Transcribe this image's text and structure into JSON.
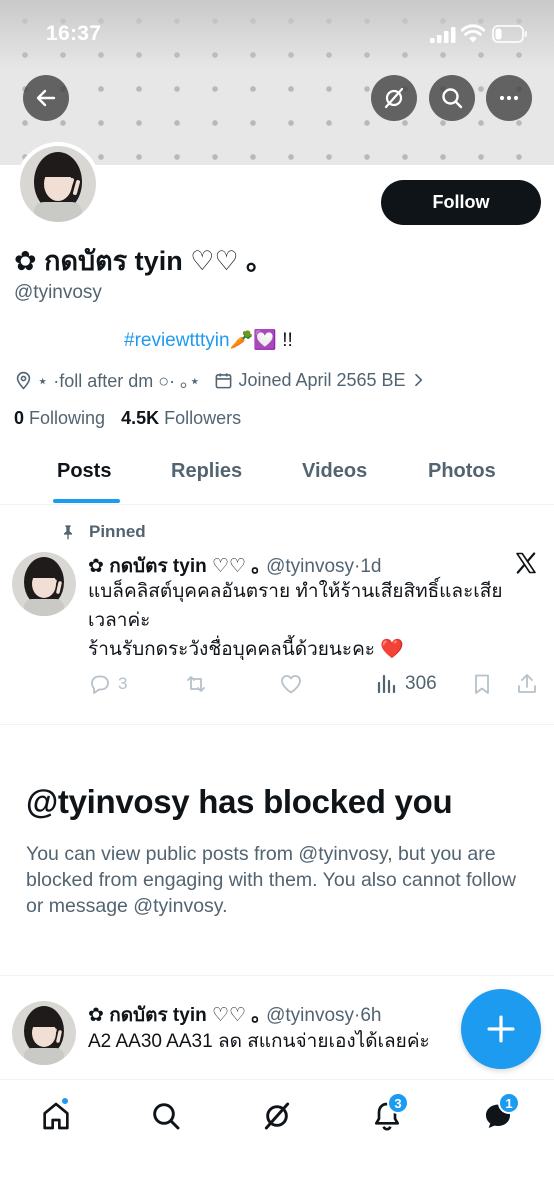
{
  "status_bar": {
    "time": "16:37"
  },
  "profile": {
    "display_name": "✿ กดบัตร tyin ♡♡ ｡",
    "handle": "@tyinvosy",
    "follow_label": "Follow",
    "bio_hashtag": "#reviewtttyin",
    "bio_suffix": "🥕💟 !!",
    "location": "⋆ ·foll after dm ○· ｡⋆",
    "joined": "Joined April 2565 BE",
    "following_count": "0",
    "following_label": "Following",
    "followers_count": "4.5K",
    "followers_label": "Followers"
  },
  "tabs": [
    {
      "label": "Posts",
      "active": true
    },
    {
      "label": "Replies",
      "active": false
    },
    {
      "label": "Videos",
      "active": false
    },
    {
      "label": "Photos",
      "active": false
    }
  ],
  "pinned_tweet": {
    "pinned_label": "Pinned",
    "author_name": "✿ กดบัตร tyin ♡♡ ｡",
    "author_handle": "@tyinvosy",
    "time": "1d",
    "text_line1": "แบล็คลิสต์บุคคลอันตราย ทำให้ร้านเสียสิทธิ์และเสีย",
    "text_line2": "เวลาค่ะ",
    "text_line3": "ร้านรับกดระวังชื่อบุคคลนี้ด้วยนะคะ ❤️",
    "replies": "3",
    "views": "306"
  },
  "blocked": {
    "title": "@tyinvosy has blocked you",
    "description": "You can view public posts from @tyinvosy, but you are blocked from engaging with them. You also cannot follow or message @tyinvosy."
  },
  "second_tweet": {
    "author_name": "✿ กดบัตร tyin ♡♡ ｡",
    "author_handle": "@tyinvosy",
    "time": "6h",
    "text": "A2 AA30 AA31 ลด สแกนจ่ายเองได้เลยค่ะ"
  },
  "bottom_nav": {
    "notifications_badge": "3",
    "messages_badge": "1"
  },
  "colors": {
    "accent": "#1d9bf0",
    "text_primary": "#0f1419",
    "text_secondary": "#536471"
  }
}
